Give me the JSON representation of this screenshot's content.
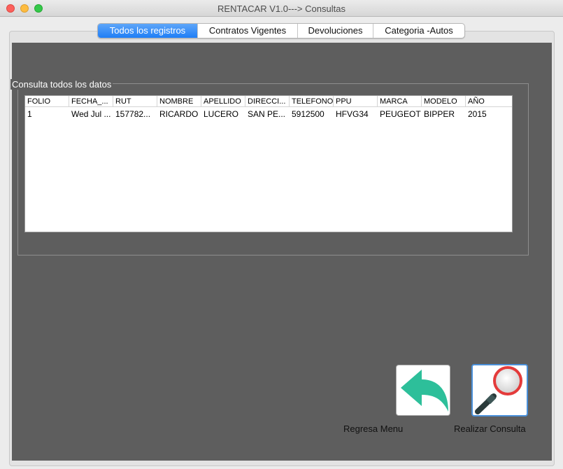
{
  "window": {
    "title": "RENTACAR V1.0---> Consultas"
  },
  "tabs": [
    {
      "label": "Todos los registros",
      "active": true
    },
    {
      "label": "Contratos Vigentes",
      "active": false
    },
    {
      "label": "Devoluciones",
      "active": false
    },
    {
      "label": "Categoria -Autos",
      "active": false
    }
  ],
  "group": {
    "title": "Consulta todos los datos"
  },
  "table": {
    "columns": [
      "FOLIO",
      "FECHA_...",
      "RUT",
      "NOMBRE",
      "APELLIDO",
      "DIRECCI...",
      "TELEFONO",
      "PPU",
      "MARCA",
      "MODELO",
      "AÑO"
    ],
    "rows": [
      [
        "1",
        "Wed Jul ...",
        "157782...",
        "RICARDO",
        "LUCERO",
        "SAN PE...",
        "5912500",
        "HFVG34",
        "PEUGEOT",
        "BIPPER",
        "2015"
      ]
    ]
  },
  "buttons": {
    "back_label": "Regresa Menu",
    "search_label": "Realizar Consulta"
  },
  "colors": {
    "panel_bg": "#5e5e5e",
    "active_tab": "#1f7ef6",
    "back_arrow": "#2dbf9a",
    "magnifier_ring": "#e43b3b"
  },
  "icons": {
    "back": "back-arrow-icon",
    "search": "magnifier-icon"
  }
}
